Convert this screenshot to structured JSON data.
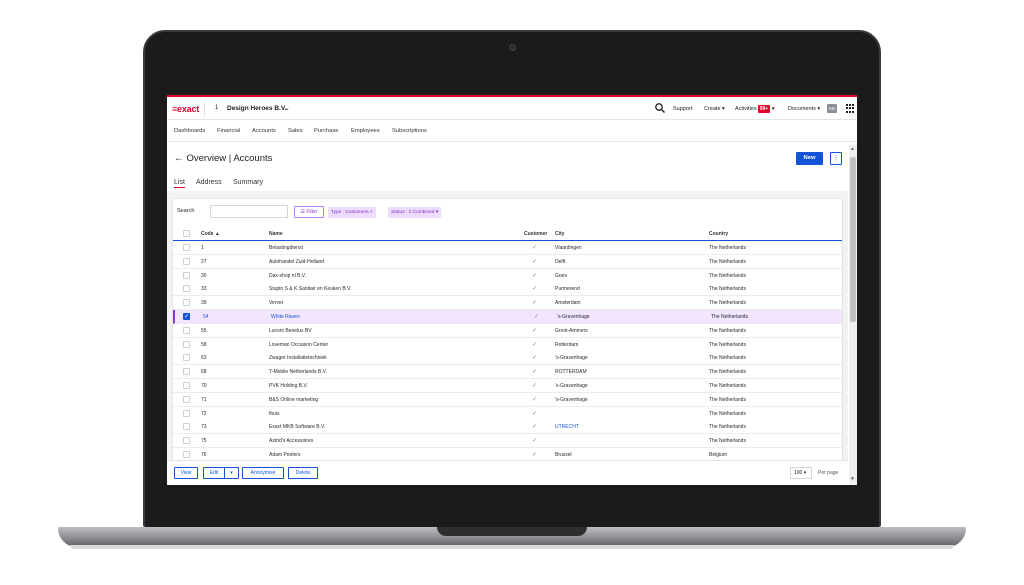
{
  "topbar": {
    "logo": "≡exact",
    "company_id": "1",
    "company_name": "Design Heroes B.V.",
    "support": "Support",
    "create": "Create ▾",
    "activities": "Activities",
    "activities_badge": "99+",
    "activities_caret": "▾",
    "documents": "Documents ▾",
    "avatar": "KB"
  },
  "mainnav": [
    "Dashboards",
    "Financial",
    "Accounts",
    "Sales",
    "Purchase",
    "Employees",
    "Subscriptions"
  ],
  "page": {
    "title": "Overview | Accounts",
    "new_label": "New",
    "more_label": "⋮"
  },
  "subtabs": [
    "List",
    "Address",
    "Summary"
  ],
  "filterbar": {
    "search_label": "Search",
    "search_value": "",
    "filter_label": "Filter",
    "chip_type": "Type : Customers ×",
    "chip_status": "Status : 2 Combined ▾"
  },
  "table": {
    "columns": {
      "code": "Code ▲",
      "name": "Name",
      "customer": "Customer",
      "city": "City",
      "country": "Country"
    },
    "rows": [
      {
        "code": "1",
        "name": "Belastingdienst",
        "customer": "✓",
        "city": "Vlaardingen",
        "country": "The Netherlands"
      },
      {
        "code": "27",
        "name": "Autohandel Zuid-Holland",
        "customer": "✓",
        "city": "Delft",
        "country": "The Netherlands"
      },
      {
        "code": "30",
        "name": "Dax-shop nl B.V.",
        "customer": "✓",
        "city": "Goes",
        "country": "The Netherlands"
      },
      {
        "code": "33",
        "name": "Stupin S & K Sanitair en Keuken B.V.",
        "customer": "✓",
        "city": "Purmerend",
        "country": "The Netherlands"
      },
      {
        "code": "39",
        "name": "Verver",
        "customer": "✓",
        "city": "Amsterdam",
        "country": "The Netherlands"
      },
      {
        "code": "54",
        "name": "White Raven",
        "customer": "✓",
        "city": "'s-Gravenhage",
        "country": "The Netherlands"
      },
      {
        "code": "55",
        "name": "Lucom Benelux BV",
        "customer": "✓",
        "city": "Groot-Ammers",
        "country": "The Netherlands"
      },
      {
        "code": "58",
        "name": "Loveman Occasion Center",
        "customer": "✓",
        "city": "Rotterdam",
        "country": "The Netherlands"
      },
      {
        "code": "63",
        "name": "Zwager Installatietechniek",
        "customer": "✓",
        "city": "'s-Gravenhage",
        "country": "The Netherlands"
      },
      {
        "code": "68",
        "name": "T-Mobile Netherlands B.V.",
        "customer": "✓",
        "city": "ROTTERDAM",
        "country": "The Netherlands"
      },
      {
        "code": "70",
        "name": "PVK Holding B.V.",
        "customer": "✓",
        "city": "'s-Gravenhage",
        "country": "The Netherlands"
      },
      {
        "code": "71",
        "name": "B&S Online marketing",
        "customer": "✓",
        "city": "'s-Gravenhage",
        "country": "The Netherlands"
      },
      {
        "code": "72",
        "name": "thuis",
        "customer": "✓",
        "city": "",
        "country": "The Netherlands"
      },
      {
        "code": "73",
        "name": "Exact MKB Software B.V.",
        "customer": "✓",
        "city": "UTRECHT",
        "country": "The Netherlands"
      },
      {
        "code": "75",
        "name": "Astrid's Accessoires",
        "customer": "✓",
        "city": "",
        "country": "The Netherlands"
      },
      {
        "code": "76",
        "name": "Adam Poolers",
        "customer": "✓",
        "city": "Brussel",
        "country": "Belgium"
      }
    ],
    "selected_row_index": 5
  },
  "footer": {
    "view": "View",
    "edit": "Edit",
    "edit_caret": "▾",
    "anonymise": "Anonymise",
    "delete": "Delete",
    "page_size": "100 ▾",
    "per_page": "Per page"
  },
  "colors": {
    "brand_red": "#e4002b",
    "primary_blue": "#1553d6",
    "chip_purple": "#7a2ec0"
  }
}
